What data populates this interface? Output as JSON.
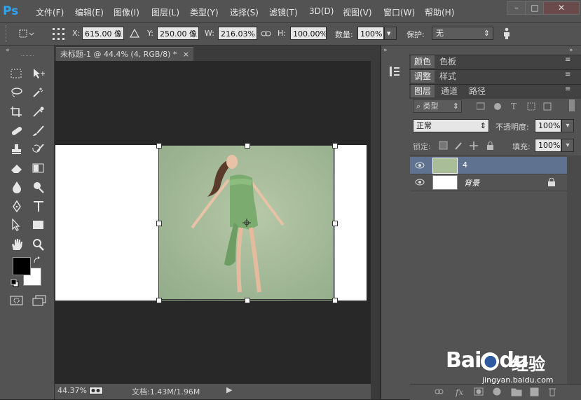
{
  "app": {
    "logo": "Ps"
  },
  "menu": [
    "文件(F)",
    "编辑(E)",
    "图像(I)",
    "图层(L)",
    "类型(Y)",
    "选择(S)",
    "滤镜(T)",
    "3D(D)",
    "视图(V)",
    "窗口(W)",
    "帮助(H)"
  ],
  "window_buttons": {
    "minimize": "–",
    "restore": "□",
    "close": "✕"
  },
  "options": {
    "x_label": "X:",
    "x_value": "615.00 像",
    "y_label": "Y:",
    "y_value": "250.00 像",
    "w_label": "W:",
    "w_value": "216.03%",
    "h_label": "H:",
    "h_value": "100.00%",
    "count_label": "数量:",
    "count_value": "100%",
    "protect_label": "保护:",
    "protect_value": "无"
  },
  "document": {
    "tab_title": "未标题-1 @ 44.4% (4, RGB/8) *",
    "tab_close": "×",
    "zoom": "44.37%",
    "doc_size": "文档:1.43M/1.96M"
  },
  "panels": {
    "group1": [
      "颜色",
      "色板"
    ],
    "group2": [
      "调整",
      "样式"
    ],
    "group3": [
      "图层",
      "通道",
      "路径"
    ],
    "filter_label": "类型",
    "blend_mode": "正常",
    "opacity_label": "不透明度:",
    "opacity_value": "100%",
    "lock_label": "锁定:",
    "fill_label": "填充:",
    "fill_value": "100%"
  },
  "layers": [
    {
      "name": "4",
      "selected": true,
      "locked": false
    },
    {
      "name": "背景",
      "selected": false,
      "locked": true
    }
  ],
  "colors": {
    "foreground": "#000000",
    "background": "#ffffff",
    "selected_layer": "#5f7391",
    "ps_blue": "#2fa3f2"
  },
  "watermark": {
    "brand": "Bai",
    "brand2": "du",
    "cn": "经验",
    "url": "jingyan.baidu.com"
  }
}
